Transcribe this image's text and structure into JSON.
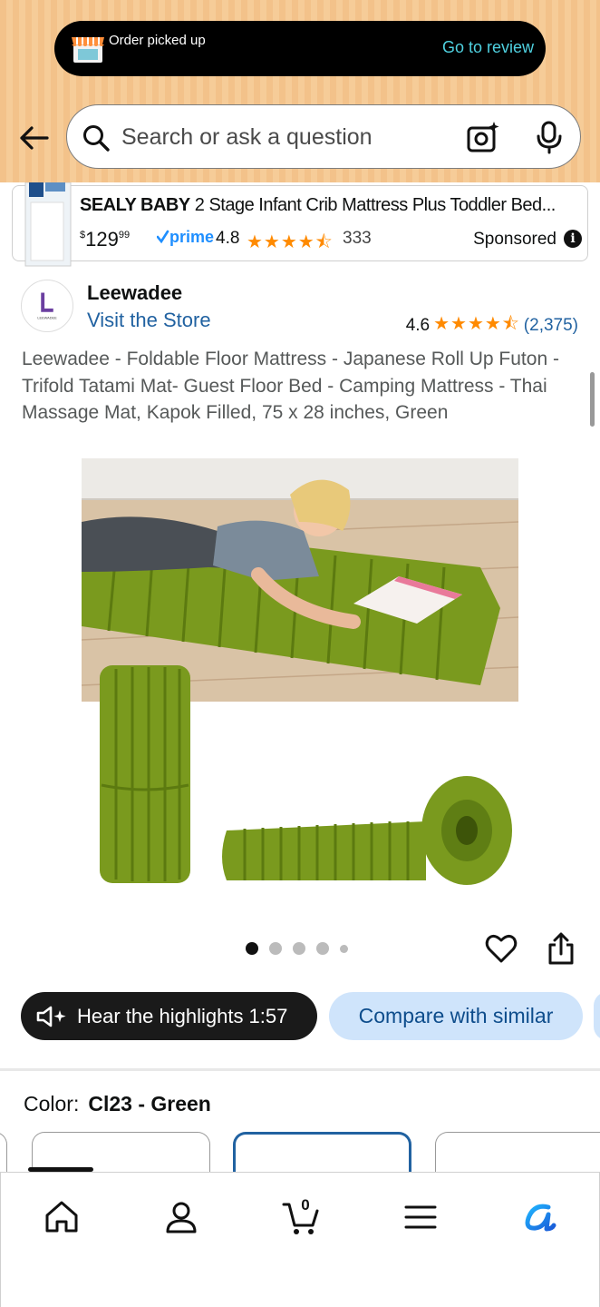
{
  "banner": {
    "text": "Order picked up",
    "action": "Go to review"
  },
  "search": {
    "placeholder": "Search or ask a question"
  },
  "sponsored": {
    "brand": "SEALY BABY",
    "title": " 2 Stage Infant Crib Mattress Plus Toddler Bed...",
    "price_currency": "$",
    "price_whole": "129",
    "price_fraction": "99",
    "prime_label": "prime",
    "rating": "4.8",
    "stars": "★★★★⯪",
    "review_count": "333",
    "label": "Sponsored",
    "info": "i"
  },
  "product": {
    "brand": "Leewadee",
    "visit_store": "Visit the Store",
    "rating": "4.6",
    "stars": "★★★★⯪",
    "review_count": "(2,375)",
    "title": "Leewadee - Foldable Floor Mattress - Japanese Roll Up Futon -Trifold Tatami Mat- Guest Floor Bed - Camping Mattress - Thai Massage Mat, Kapok Filled, 75 x 28 inches, Green",
    "image_count": 5,
    "active_image": 1
  },
  "actions": {
    "hear": "Hear the highlights 1:57",
    "compare": "Compare with similar"
  },
  "color": {
    "label": "Color:",
    "value": "Cl23 - Green"
  },
  "nav": {
    "cart_count": "0",
    "items": [
      "home-icon",
      "account-icon",
      "cart-icon",
      "menu-icon",
      "rufus-icon"
    ]
  },
  "colors": {
    "accent_link": "#2162a1",
    "star": "#ff8a00",
    "header_bg": "#f4c690",
    "compare_bg": "#cfe4fb"
  }
}
